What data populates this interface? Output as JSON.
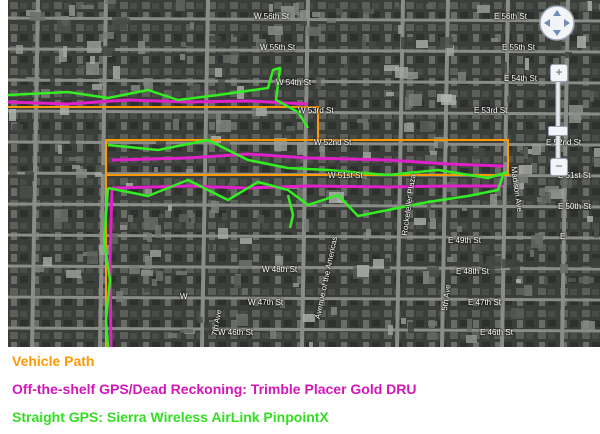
{
  "map": {
    "streets": {
      "w56": "W 56th St",
      "e56": "E 56th St",
      "w55": "W 55th St",
      "e55": "E 55th St",
      "w54": "W 54th St",
      "e54": "E 54th St",
      "w53": "W 53rd St",
      "e53": "E 53rd St",
      "w52": "W 52nd St",
      "e52": "E 52nd St",
      "w51": "W 51st St",
      "e51": "E 51st St",
      "e50": "E 50th St",
      "e49": "E 49th St",
      "e48": "E 48th St",
      "w48": "W 48th St",
      "w47": "W 47th St",
      "e47": "E 47th St",
      "w46": "W 46th St",
      "e46": "E 46th St",
      "ave_americas": "Avenue of the Americas",
      "rockefeller": "Rockefeller Plaza",
      "fifth_ave": "5th Ave",
      "madison": "Madison Ave",
      "seventh_ave": "7th Ave",
      "w_partial": "W",
      "e_partial": "E"
    },
    "controls": {
      "pan": "pan-control",
      "zoom_in": "+",
      "zoom_out": "−"
    },
    "colors": {
      "vehicle_path": "#ff9900",
      "dead_reckoning": "#e020c8",
      "straight_gps": "#33ee22"
    }
  },
  "legend": {
    "vehicle_path": "Vehicle Path",
    "dead_reckoning": "Off-the-shelf GPS/Dead Reckoning: Trimble Placer Gold DRU",
    "straight_gps": "Straight GPS: Sierra Wireless AirLink PinpointX"
  }
}
